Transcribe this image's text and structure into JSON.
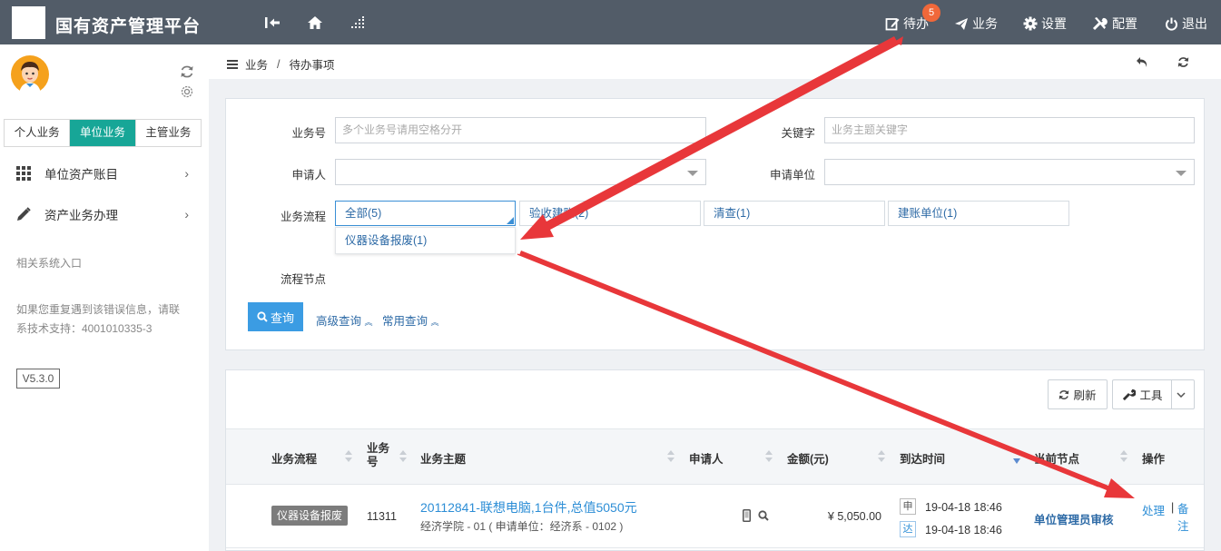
{
  "header": {
    "app_title": "国有资产管理平台",
    "nav": [
      {
        "label": "待办",
        "icon": "edit-icon"
      },
      {
        "label": "业务",
        "icon": "paper-plane-icon"
      },
      {
        "label": "设置",
        "icon": "gear-icon"
      },
      {
        "label": "配置",
        "icon": "tools-icon"
      },
      {
        "label": "退出",
        "icon": "power-icon"
      }
    ],
    "todo_badge": "5"
  },
  "sidebar": {
    "tabs": [
      "个人业务",
      "单位业务",
      "主管业务"
    ],
    "active_tab": "单位业务",
    "menu": [
      {
        "label": "单位资产账目",
        "icon": "grid-icon"
      },
      {
        "label": "资产业务办理",
        "icon": "pencil-icon"
      }
    ],
    "related_title": "相关系统入口",
    "help_line1": "如果您重复遇到该错误信息，请联",
    "help_line2": "系技术支持：4001010335-3",
    "version": "V5.3.0"
  },
  "breadcrumb": {
    "items": [
      "业务",
      "待办事项"
    ]
  },
  "search": {
    "labels": {
      "business_no": "业务号",
      "keyword": "关键字",
      "applicant": "申请人",
      "applicant_unit": "申请单位",
      "flow": "业务流程",
      "node": "流程节点"
    },
    "placeholders": {
      "business_no": "多个业务号请用空格分开",
      "keyword": "业务主题关键字"
    },
    "flow_options": [
      "全部(5)",
      "验收建账(2)",
      "清查(1)",
      "建账单位(1)"
    ],
    "dropdown_option": "仪器设备报废(1)",
    "query_button": "查询",
    "advanced_link": "高级查询",
    "common_link": "常用查询"
  },
  "toolbar": {
    "refresh": "刷新",
    "tools": "工具"
  },
  "table": {
    "columns": [
      "业务流程",
      "业务号",
      "业务主题",
      "申请人",
      "金额(元)",
      "到达时间",
      "当前节点",
      "操作"
    ],
    "rows": [
      {
        "flow": "仪器设备报废",
        "no": "11311",
        "subject": "20112841-联想电脑,1台件,总值5050元",
        "subject_sub": "经济学院 - 01 ( 申请单位：经济系 - 0102 )",
        "amount": "¥ 5,050.00",
        "apply_tag": "申",
        "apply_time": "19-04-18 18:46",
        "arrive_tag": "达",
        "arrive_time": "19-04-18 18:46",
        "node": "单位管理员审核",
        "op_process": "处理",
        "op_sep": "|",
        "op_note": "备注"
      }
    ]
  },
  "colors": {
    "header_bg": "#525c68",
    "active_tab": "#17a697",
    "primary": "#3b9ce3",
    "link": "#2d6aa6",
    "badge": "#f0683a",
    "arrow": "#e8373a"
  }
}
